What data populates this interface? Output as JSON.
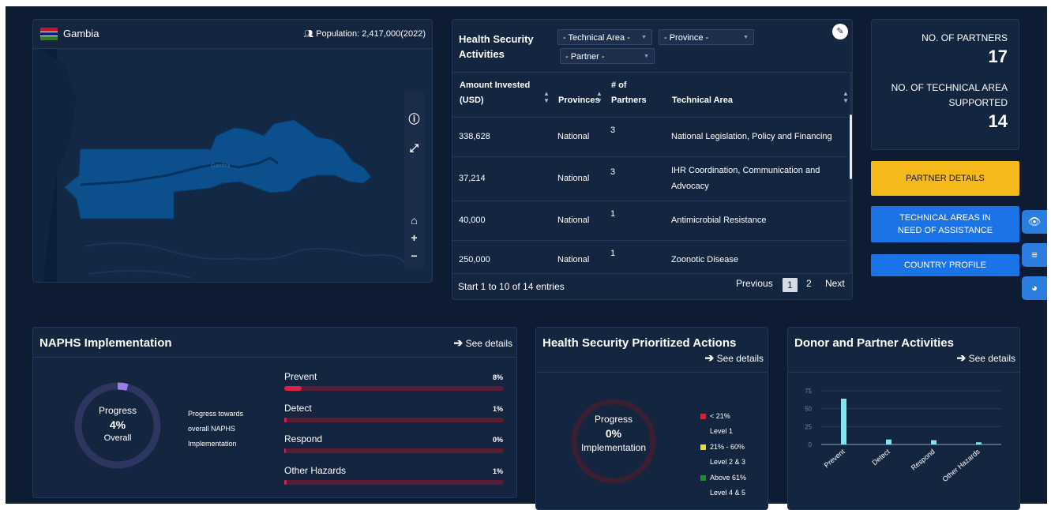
{
  "map": {
    "country": "Gambia",
    "population_label": "Population: 2,417,000(2022)",
    "map_label": "Gambia",
    "flag_colors": [
      "#ce1126",
      "#ffffff",
      "#0c1c8c",
      "#ffffff",
      "#3a7728"
    ],
    "tools": [
      "info-icon",
      "expand-icon",
      "home-icon",
      "zoom-in-icon",
      "zoom-out-icon"
    ]
  },
  "table": {
    "title_line1": "Health Security",
    "title_line2": "Activities",
    "filters": {
      "technical_area": "- Technical Area -",
      "province": "- Province -",
      "partner": "- Partner -"
    },
    "headers": {
      "amount1": "Amount Invested",
      "amount2": "(USD)",
      "provinces": "Provinces",
      "partners1": "# of",
      "partners2": "Partners",
      "technical_area": "Technical Area"
    },
    "rows": [
      {
        "amount": "338,628",
        "province": "National",
        "partners": "3",
        "area1": "National Legislation, Policy and Financing",
        "area2": ""
      },
      {
        "amount": "37,214",
        "province": "National",
        "partners": "3",
        "area1": "IHR Coordination, Communication and",
        "area2": "Advocacy"
      },
      {
        "amount": "40,000",
        "province": "National",
        "partners": "1",
        "area1": "Antimicrobial Resistance",
        "area2": ""
      },
      {
        "amount": "250,000",
        "province": "National",
        "partners": "1",
        "area1": "Zoonotic Disease",
        "area2": ""
      }
    ],
    "footer": "Start 1 to 10 of 14 entries",
    "pager": {
      "previous": "Previous",
      "page1": "1",
      "page2": "2",
      "next": "Next"
    }
  },
  "stats": {
    "partners_label": "NO. OF PARTNERS",
    "partners_value": "17",
    "tech_label1": "NO. OF TECHNICAL AREA",
    "tech_label2": "SUPPORTED",
    "tech_value": "14"
  },
  "buttons": {
    "partner_details": "PARTNER DETAILS",
    "tech_areas1": "TECHNICAL AREAS IN",
    "tech_areas2": "NEED OF ASSISTANCE",
    "country_profile": "COUNTRY PROFILE"
  },
  "side_icons": [
    "eye-icon",
    "layers-icon",
    "dashboard-icon"
  ],
  "colors": {
    "accent_yellow": "#f5b91c",
    "accent_blue": "#1a74e8",
    "progress_red": "#e01e46",
    "bar_cyan": "#7ee6ef"
  },
  "naphs": {
    "title": "NAPHS Implementation",
    "see_details": "See details",
    "progress_label": "Progress",
    "progress_value": "4%",
    "progress_sub": "Overall",
    "progress_fraction": 0.04,
    "note1": "Progress towards",
    "note2": "overall NAPHS",
    "note3": "Implementation",
    "bars": [
      {
        "label": "Prevent",
        "pct": "8%",
        "value": 8
      },
      {
        "label": "Detect",
        "pct": "1%",
        "value": 1
      },
      {
        "label": "Respond",
        "pct": "0%",
        "value": 0
      },
      {
        "label": "Other Hazards",
        "pct": "1%",
        "value": 1
      }
    ]
  },
  "hspa": {
    "title": "Health Security Prioritized Actions",
    "see_details": "See details",
    "progress_label": "Progress",
    "progress_value": "0%",
    "progress_sub": "Implementation",
    "legend": [
      {
        "range": "< 21%",
        "level": "Level 1",
        "color": "#e01e2c"
      },
      {
        "range": "21% - 60%",
        "level": "Level 2 & 3",
        "color": "#f2dc18"
      },
      {
        "range": "Above 61%",
        "level": "Level 4 & 5",
        "color": "#1f8a2e"
      }
    ]
  },
  "donor": {
    "title": "Donor and Partner Activities",
    "see_details": "See details"
  },
  "chart_data": {
    "type": "bar",
    "categories": [
      "Prevent",
      "Detect",
      "Respond",
      "Other Hazards"
    ],
    "values": [
      64,
      7,
      6,
      3
    ],
    "yticks": [
      0,
      25,
      50,
      75
    ],
    "ylim": [
      0,
      75
    ],
    "grid": true
  }
}
